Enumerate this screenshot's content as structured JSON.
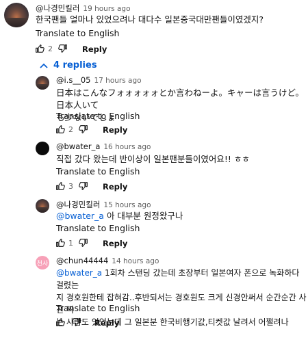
{
  "top_comment": {
    "handle": "@나경민킬러",
    "time": "19 hours ago",
    "text": "한국팬들 얼마나 있었으려나 대다수 일본중국대만팬들이였겠지?",
    "translate": "Translate to English",
    "likes": "2",
    "reply": "Reply"
  },
  "replies_toggle": {
    "label": "4 replies",
    "icon": "chevron-up-icon"
  },
  "replies": [
    {
      "handle": "@i.s__05",
      "time": "17 hours ago",
      "text_line1": "日本はこんなフォォォォォとか言わねーよ。キャーは言うけど。日本人いて",
      "text_line2": "も少ないでしょ",
      "translate": "Translate to English",
      "likes": "2",
      "reply": "Reply"
    },
    {
      "handle": "@bwater_a",
      "time": "16 hours ago",
      "text": "직접 갔다 왔는데 반이상이 일본팬분들이였어요!! ㅎㅎ",
      "translate": "Translate to English",
      "likes": "3",
      "reply": "Reply"
    },
    {
      "handle": "@나경민킬러",
      "time": "15 hours ago",
      "mention": "@bwater_a",
      "text": " 아 대부분 원정왔구나",
      "translate": "Translate to English",
      "likes": "1",
      "reply": "Reply"
    },
    {
      "handle": "@chun44444",
      "time": "14 hours ago",
      "avatar_text": "천사",
      "mention": "@bwater_a",
      "text_line1": " 1회차 스탠딩 갔는데 초장부터 일본여자 폰으로 녹화하다 걸렸는",
      "text_line2": "지 경호원한테 잡혀감..후반되서는 경호원도 크게 신경안써서 순간순간 사진 찍",
      "text_line3": "는 사람도 있었는데 그 일본분 한국비행기값,티켓값 날려서 어쩔려나",
      "translate": "Translate to English",
      "reply": "Reply"
    }
  ],
  "colors": {
    "link": "#065fd4",
    "meta": "#606060",
    "avatar_pink": "#f7a1b8"
  }
}
